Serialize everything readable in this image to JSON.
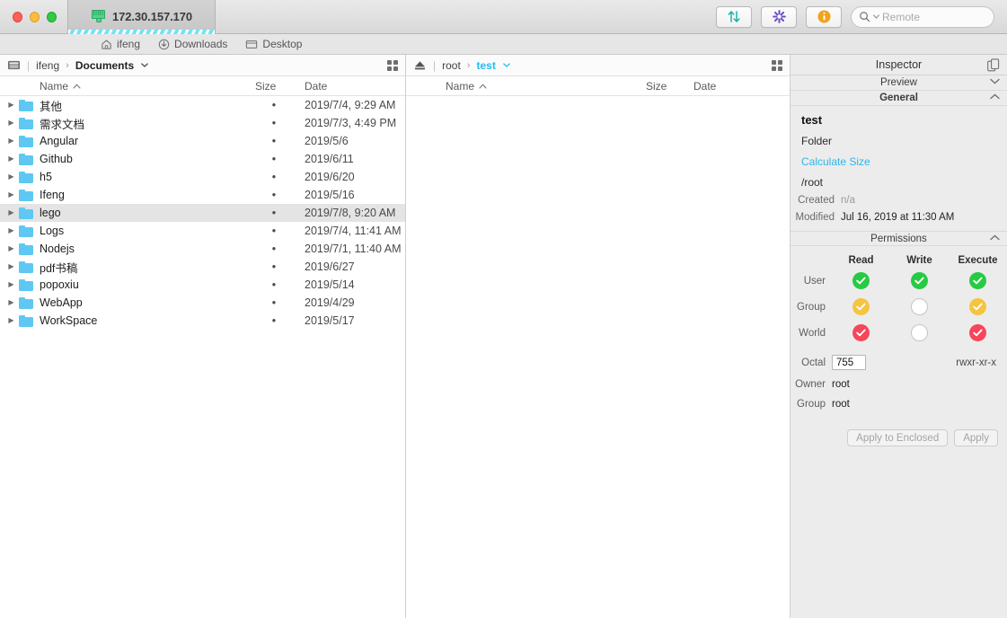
{
  "titlebar": {
    "tab_label": "172.30.157.170",
    "tab_icon": "ethernet-icon",
    "buttons": [
      {
        "name": "transfers-button",
        "icon": "up-down-arrows-icon"
      },
      {
        "name": "sync-button",
        "icon": "asterisk-icon"
      },
      {
        "name": "info-button",
        "icon": "info-circle-icon"
      }
    ],
    "search": {
      "placeholder": "Remote",
      "value": "",
      "icon": "search-icon"
    }
  },
  "bookmarks": [
    {
      "label": "ifeng",
      "icon": "home-icon"
    },
    {
      "label": "Downloads",
      "icon": "download-circle-icon"
    },
    {
      "label": "Desktop",
      "icon": "desktop-icon"
    }
  ],
  "left_pane": {
    "path_icon": "drive-icon",
    "crumbs": [
      "ifeng",
      "Documents"
    ],
    "view_toggle_icon": "grid-view-icon",
    "columns": {
      "name": "Name",
      "size": "Size",
      "date": "Date",
      "sort": "ascending"
    },
    "rows": [
      {
        "name": "其他",
        "size": "•",
        "date": "2019/7/4, 9:29 AM",
        "selected": false
      },
      {
        "name": "需求文档",
        "size": "•",
        "date": "2019/7/3, 4:49 PM",
        "selected": false
      },
      {
        "name": "Angular",
        "size": "•",
        "date": "2019/5/6",
        "selected": false
      },
      {
        "name": "Github",
        "size": "•",
        "date": "2019/6/11",
        "selected": false
      },
      {
        "name": "h5",
        "size": "•",
        "date": "2019/6/20",
        "selected": false
      },
      {
        "name": "Ifeng",
        "size": "•",
        "date": "2019/5/16",
        "selected": false
      },
      {
        "name": "lego",
        "size": "•",
        "date": "2019/7/8, 9:20 AM",
        "selected": true
      },
      {
        "name": "Logs",
        "size": "•",
        "date": "2019/7/4, 11:41 AM",
        "selected": false
      },
      {
        "name": "Nodejs",
        "size": "•",
        "date": "2019/7/1, 11:40 AM",
        "selected": false
      },
      {
        "name": "pdf书稿",
        "size": "•",
        "date": "2019/6/27",
        "selected": false
      },
      {
        "name": "popoxiu",
        "size": "•",
        "date": "2019/5/14",
        "selected": false
      },
      {
        "name": "WebApp",
        "size": "•",
        "date": "2019/4/29",
        "selected": false
      },
      {
        "name": "WorkSpace",
        "size": "•",
        "date": "2019/5/17",
        "selected": false
      }
    ]
  },
  "right_pane": {
    "path_icon": "eject-icon",
    "crumbs": [
      "root",
      "test"
    ],
    "view_toggle_icon": "grid-view-icon",
    "columns": {
      "name": "Name",
      "size": "Size",
      "date": "Date",
      "sort": "ascending"
    },
    "rows": []
  },
  "inspector": {
    "title": "Inspector",
    "copy_icon": "duplicate-icon",
    "sections": {
      "preview": {
        "label": "Preview",
        "expanded": false
      },
      "general": {
        "label": "General",
        "expanded": true
      },
      "permissions": {
        "label": "Permissions",
        "expanded": true
      }
    },
    "general": {
      "name": "test",
      "kind": "Folder",
      "calculate_size": "Calculate Size",
      "path": "/root",
      "created_label": "Created",
      "created_value": "n/a",
      "modified_label": "Modified",
      "modified_value": "Jul 16, 2019 at 11:30 AM"
    },
    "permissions": {
      "columns": [
        "Read",
        "Write",
        "Execute"
      ],
      "rows": [
        {
          "label": "User",
          "read": "on",
          "write": "on",
          "execute": "on"
        },
        {
          "label": "Group",
          "read": "on",
          "write": "off",
          "execute": "on"
        },
        {
          "label": "World",
          "read": "on",
          "write": "off",
          "execute": "on"
        }
      ],
      "row_colors": {
        "User": "#27ca43",
        "Group": "#f5c440",
        "World": "#f6465b"
      },
      "octal_label": "Octal",
      "octal_value": "755",
      "symbolic": "rwxr-xr-x",
      "owner_label": "Owner",
      "owner_value": "root",
      "group_label": "Group",
      "group_value": "root",
      "apply_enclosed_label": "Apply to Enclosed",
      "apply_label": "Apply"
    }
  },
  "colors": {
    "accent": "#22bdf0",
    "folder": "#5ec8f2",
    "green": "#27ca43",
    "yellow": "#f5c440",
    "red": "#f6465b",
    "link": "#2bb6e8"
  }
}
